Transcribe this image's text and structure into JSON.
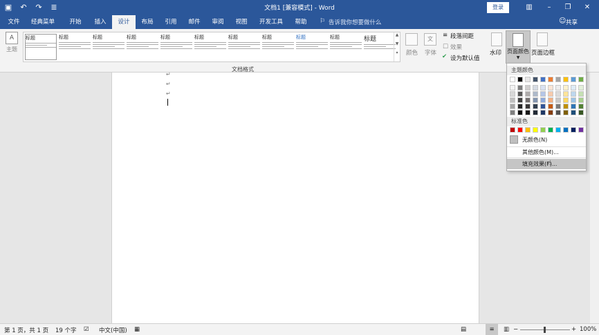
{
  "title_bar": {
    "title": "文档1 [兼容模式] - Word",
    "login_label": "登录",
    "qat": {
      "save_icon": "save-icon",
      "undo_icon": "undo-icon",
      "redo_icon": "redo-icon",
      "more_icon": "customize-icon"
    }
  },
  "tabs": [
    {
      "label": "文件"
    },
    {
      "label": "经典菜单"
    },
    {
      "label": "开始"
    },
    {
      "label": "插入"
    },
    {
      "label": "设计",
      "active": true
    },
    {
      "label": "布局"
    },
    {
      "label": "引用"
    },
    {
      "label": "邮件"
    },
    {
      "label": "审阅"
    },
    {
      "label": "视图"
    },
    {
      "label": "开发工具"
    },
    {
      "label": "帮助"
    }
  ],
  "tell_me": "告诉我你想要做什么",
  "share_label": "共享",
  "ribbon": {
    "theme_label": "主题",
    "gallery_items": [
      {
        "title": "标题",
        "blue": false
      },
      {
        "title": "标题",
        "blue": false
      },
      {
        "title": "标题",
        "blue": false
      },
      {
        "title": "标题",
        "blue": false
      },
      {
        "title": "标题",
        "blue": false
      },
      {
        "title": "标题",
        "blue": false
      },
      {
        "title": "标题",
        "blue": false
      },
      {
        "title": "标题",
        "blue": false
      },
      {
        "title": "标题",
        "blue": true
      },
      {
        "title": "标题",
        "blue": false
      },
      {
        "title": "标题",
        "blue": false
      }
    ],
    "group_label": "文档格式",
    "colors_label": "颜色",
    "fonts_label": "字体",
    "para_spacing": "段落间距",
    "effects": "效果",
    "set_default": "设为默认值",
    "watermark": "水印",
    "page_color": "页面颜色",
    "page_border": "页面边框"
  },
  "dropdown": {
    "theme_colors_label": "主题颜色",
    "standard_colors_label": "标准色",
    "no_color": "无颜色(N)",
    "more_colors": "其他颜色(M)...",
    "fill_effects": "填充效果(F)...",
    "theme_top_row": [
      "#ffffff",
      "#000000",
      "#e7e6e6",
      "#44546a",
      "#4472c4",
      "#ed7d31",
      "#a5a5a5",
      "#ffc000",
      "#5b9bd5",
      "#70ad47"
    ],
    "theme_shades": [
      [
        "#f2f2f2",
        "#7f7f7f",
        "#d0cece",
        "#d6dce4",
        "#d9e2f3",
        "#fbe5d5",
        "#ededed",
        "#fff2cc",
        "#deebf6",
        "#e2efd9"
      ],
      [
        "#d8d8d8",
        "#595959",
        "#aeabab",
        "#adb9ca",
        "#b4c6e7",
        "#f7cbac",
        "#dbdbdb",
        "#fee599",
        "#bdd7ee",
        "#c5e0b3"
      ],
      [
        "#bfbfbf",
        "#3f3f3f",
        "#757070",
        "#8496b0",
        "#8eaadb",
        "#f4b183",
        "#c9c9c9",
        "#ffd965",
        "#9cc3e5",
        "#a8d08d"
      ],
      [
        "#a5a5a5",
        "#262626",
        "#3a3838",
        "#323f4f",
        "#2f5496",
        "#c55a11",
        "#7b7b7b",
        "#bf9000",
        "#2e75b5",
        "#538135"
      ],
      [
        "#7f7f7f",
        "#0c0c0c",
        "#171616",
        "#222a35",
        "#1f3864",
        "#833c0b",
        "#525252",
        "#7f6000",
        "#1e4e79",
        "#375623"
      ]
    ],
    "standard": [
      "#c00000",
      "#ff0000",
      "#ffc000",
      "#ffff00",
      "#92d050",
      "#00b050",
      "#00b0f0",
      "#0070c0",
      "#002060",
      "#7030a0"
    ]
  },
  "status": {
    "page": "第 1 页，共 1 页",
    "words": "19 个字",
    "lang": "中文(中国)",
    "zoom": "100%"
  }
}
